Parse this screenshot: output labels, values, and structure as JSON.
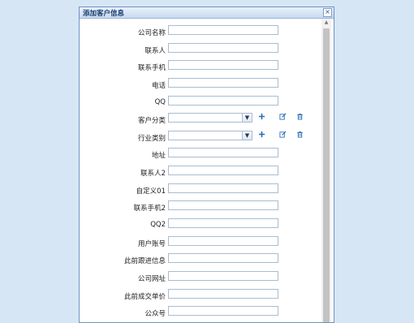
{
  "dialog": {
    "title": "添加客户信息",
    "close_glyph": "×"
  },
  "fields": [
    {
      "label": "公司名称",
      "type": "text",
      "value": ""
    },
    {
      "label": "联系人",
      "type": "text",
      "value": ""
    },
    {
      "label": "联系手机",
      "type": "text",
      "value": ""
    },
    {
      "label": "电话",
      "type": "text",
      "value": ""
    },
    {
      "label": "QQ",
      "type": "text",
      "value": ""
    },
    {
      "label": "客户分类",
      "type": "select",
      "value": "",
      "actions": [
        "plus-icon",
        "edit-icon",
        "delete-icon"
      ]
    },
    {
      "label": "行业类别",
      "type": "select",
      "value": "",
      "actions": [
        "plus-icon",
        "edit-icon",
        "delete-icon"
      ]
    },
    {
      "label": "地址",
      "type": "text",
      "value": ""
    },
    {
      "label": "联系人2",
      "type": "text",
      "value": ""
    },
    {
      "label": "自定义01",
      "type": "text",
      "value": ""
    },
    {
      "label": "联系手机2",
      "type": "text",
      "value": ""
    },
    {
      "label": "QQ2",
      "type": "text",
      "value": ""
    },
    {
      "label": "用户账号",
      "type": "text",
      "value": ""
    },
    {
      "label": "此前跟进信息",
      "type": "text",
      "value": ""
    },
    {
      "label": "公司网址",
      "type": "text",
      "value": ""
    },
    {
      "label": "此前成交单价",
      "type": "text",
      "value": ""
    },
    {
      "label": "公众号",
      "type": "text",
      "value": ""
    }
  ],
  "colors": {
    "page_background": "#d7e6f5",
    "dialog_border": "#6f93c1",
    "title_text": "#1a3d6e",
    "action_icon": "#2c6fb5"
  }
}
